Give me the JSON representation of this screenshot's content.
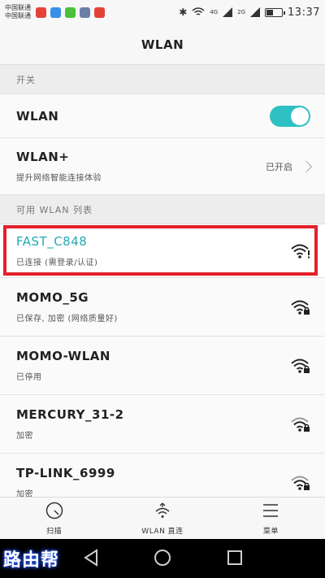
{
  "status_bar": {
    "carrier1": "中国联通",
    "carrier2": "中国联通",
    "net1": "4G",
    "net2": "2G",
    "time": "13:37",
    "notification_icons": [
      "weibo-icon",
      "wechat-icon",
      "weibo-icon",
      "gallery-icon",
      "weibo-icon"
    ]
  },
  "header": {
    "title": "WLAN"
  },
  "sections": {
    "switch_header": "开关",
    "list_header": "可用 WLAN 列表"
  },
  "wlan_toggle": {
    "label": "WLAN",
    "on": true
  },
  "wlan_plus": {
    "label": "WLAN+",
    "sub": "提升网络智能连接体验",
    "status": "已开启"
  },
  "networks": [
    {
      "name": "FAST_C848",
      "status": "已连接 (需登录/认证)",
      "connected": true,
      "icon": "wifi-alert-icon"
    },
    {
      "name": "MOMO_5G",
      "status": "已保存, 加密 (网络质量好)",
      "connected": false,
      "icon": "wifi-lock-icon"
    },
    {
      "name": "MOMO-WLAN",
      "status": "已停用",
      "connected": false,
      "icon": "wifi-lock-icon"
    },
    {
      "name": "MERCURY_31-2",
      "status": "加密",
      "connected": false,
      "icon": "wifi-lock-icon"
    },
    {
      "name": "TP-LINK_6999",
      "status": "加密",
      "connected": false,
      "icon": "wifi-lock-icon"
    }
  ],
  "bottom_nav": [
    {
      "label": "扫描",
      "icon": "scan-icon"
    },
    {
      "label": "WLAN 直连",
      "icon": "wifi-direct-icon"
    },
    {
      "label": "菜单",
      "icon": "menu-icon"
    }
  ],
  "watermark": "路由帮",
  "colors": {
    "accent": "#2ec1c3",
    "connected_text": "#23a8b4",
    "highlight": "#e2212b"
  }
}
